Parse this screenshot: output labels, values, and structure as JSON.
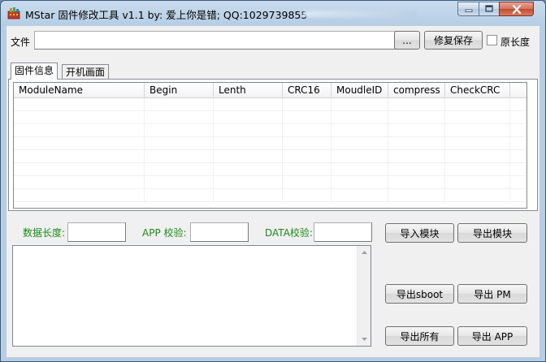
{
  "window": {
    "title": "MStar 固件修改工具 v1.1   by: 爱上你是错; QQ:1029739855"
  },
  "file_row": {
    "label": "文件",
    "path_value": "",
    "browse_label": "...",
    "repair_save_label": "修复保存",
    "original_length_label": "原长度",
    "original_length_checked": false
  },
  "tabs": [
    {
      "label": "固件信息",
      "active": true
    },
    {
      "label": "开机画面",
      "active": false
    }
  ],
  "module_table": {
    "columns": [
      "ModuleName",
      "Begin",
      "Lenth",
      "CRC16",
      "MoudleID",
      "compress",
      "CheckCRC"
    ],
    "rows": []
  },
  "fields": {
    "data_length_label": "数据长度:",
    "data_length_value": "",
    "app_check_label": "APP 校验:",
    "app_check_value": "",
    "data_check_label": "DATA校验:",
    "data_check_value": ""
  },
  "buttons": {
    "import_module": "导入模块",
    "export_module": "导出模块",
    "export_sboot": "导出sboot",
    "export_pm": "导出 PM",
    "export_all": "导出所有",
    "export_app": "导出 APP"
  },
  "log_text": "",
  "colors": {
    "label_green": "#1a8a1a",
    "close_red": "#c24a31"
  }
}
